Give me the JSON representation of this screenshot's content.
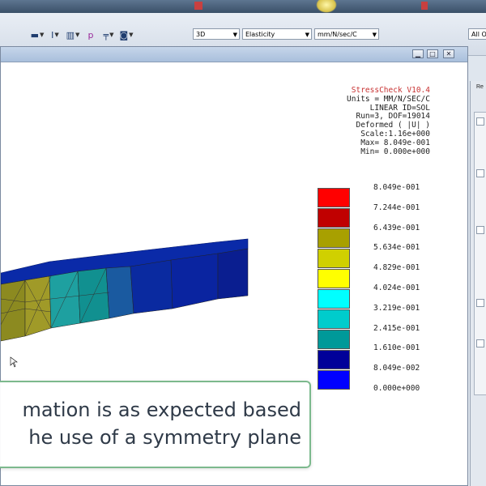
{
  "toolbar": {
    "icons": [
      "box-icon",
      "dimension-icon",
      "chart-icon",
      "p-icon",
      "constraint-icon",
      "load-icon"
    ],
    "view_select": "3D",
    "analysis_select": "Elasticity",
    "units_select": "mm/N/sec/C",
    "filter_select": "All Ob"
  },
  "viewport": {
    "info": {
      "product": "StressCheck V10.4",
      "units": "Units = MM/N/SEC/C",
      "solution": "LINEAR ID=SOL",
      "run": "Run=3, DOF=19014",
      "deformed": "Deformed ( |U| )",
      "scale": "Scale:1.16e+000",
      "max": "Max= 8.049e-001",
      "min": "Min= 0.000e+000"
    },
    "legend": {
      "labels": [
        "8.049e-001",
        "7.244e-001",
        "6.439e-001",
        "5.634e-001",
        "4.829e-001",
        "4.024e-001",
        "3.219e-001",
        "2.415e-001",
        "1.610e-001",
        "8.049e-002",
        "0.000e+000"
      ],
      "colors": [
        "#ff0000",
        "#c00000",
        "#a8a000",
        "#d0d000",
        "#ffff00",
        "#00ffff",
        "#00cccc",
        "#009999",
        "#000099",
        "#0000ff"
      ]
    }
  },
  "caption": {
    "line1": "mation is as expected based",
    "line2": "he use of a symmetry plane"
  },
  "side_panel": {
    "label": "Re"
  }
}
